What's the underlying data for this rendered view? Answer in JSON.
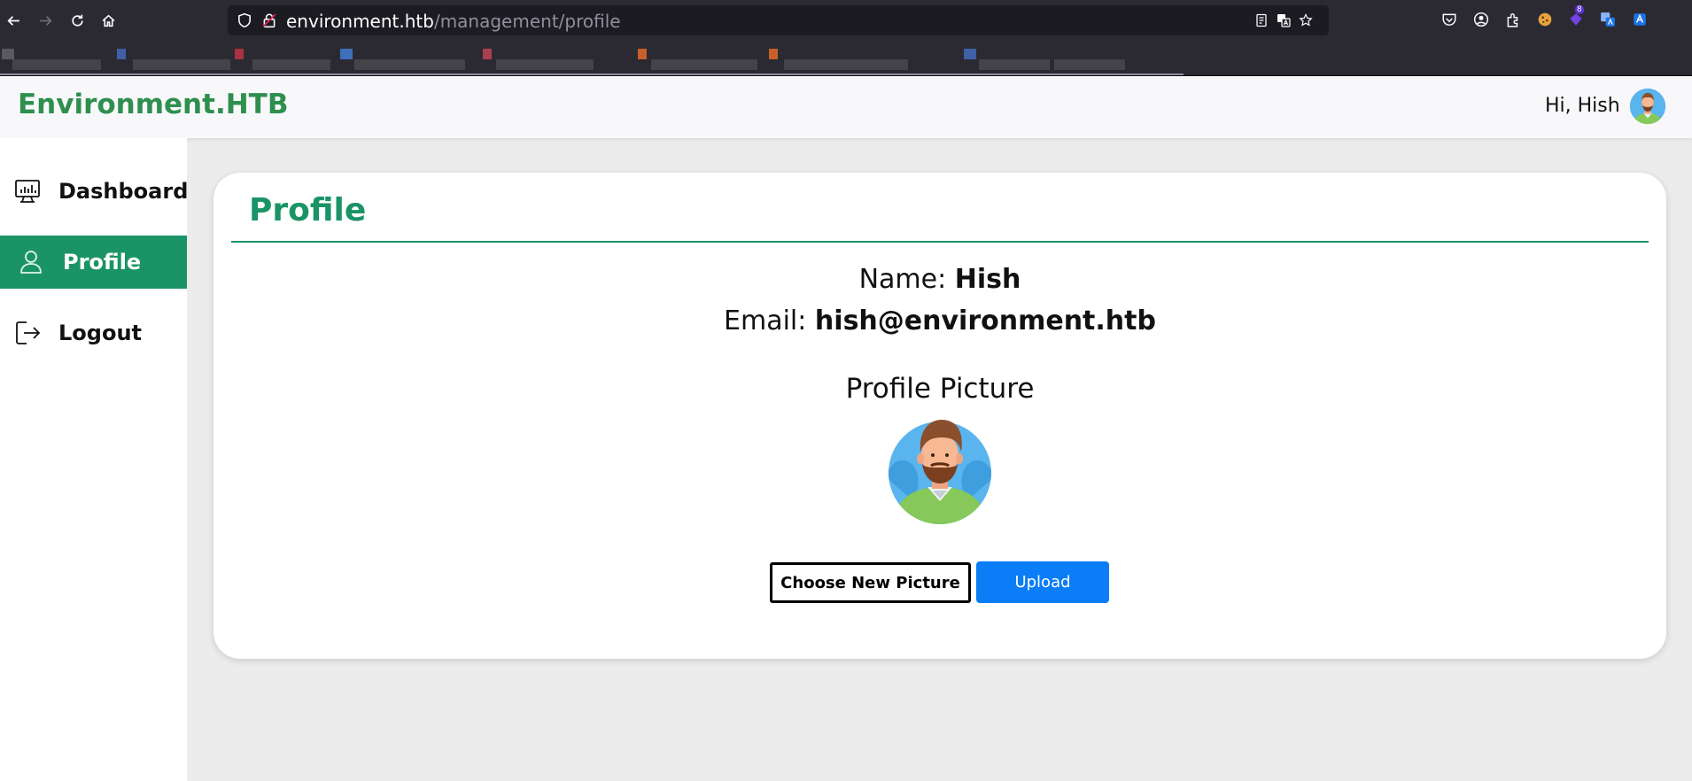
{
  "browser": {
    "url_host": "environment.htb",
    "url_path": "/management/profile",
    "extension_badge": "8",
    "icons": [
      "back-icon",
      "forward-icon",
      "reload-icon",
      "home-icon",
      "shield-icon",
      "lock-icon",
      "reader-icon",
      "translate-icon",
      "star-icon",
      "pocket-icon",
      "account-icon",
      "extensions-icon"
    ]
  },
  "header": {
    "brand": "Environment.HTB",
    "greeting": "Hi, Hish"
  },
  "sidebar": {
    "items": [
      {
        "label": "Dashboard",
        "icon": "dashboard-icon"
      },
      {
        "label": "Profile",
        "icon": "user-icon"
      },
      {
        "label": "Logout",
        "icon": "logout-icon"
      }
    ]
  },
  "profile": {
    "title": "Profile",
    "name_label": "Name:",
    "name_value": "Hish",
    "email_label": "Email:",
    "email_value": "hish@environment.htb",
    "picture_label": "Profile Picture",
    "choose_button": "Choose New Picture",
    "upload_button": "Upload"
  },
  "colors": {
    "brand_green": "#2f8f4e",
    "accent_green": "#1a9466",
    "upload_blue": "#0a7df7",
    "chrome_dark": "#2b2a33"
  }
}
